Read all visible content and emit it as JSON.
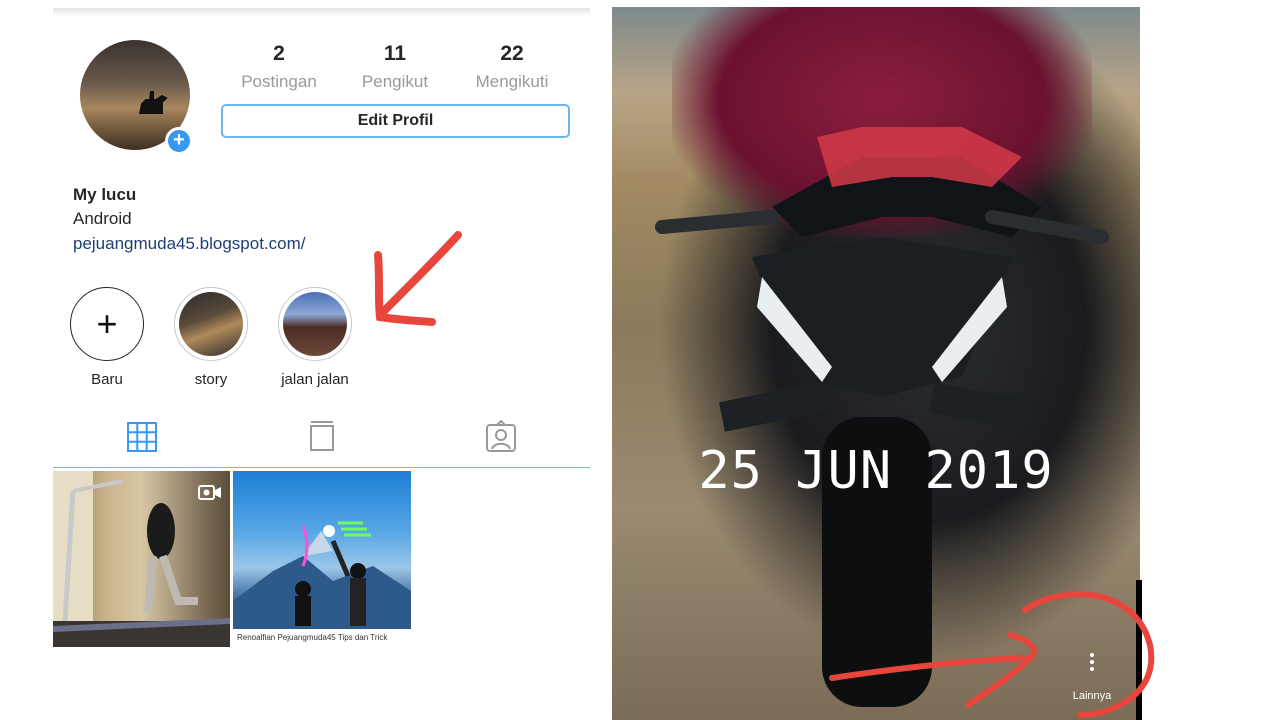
{
  "profile": {
    "stats": [
      {
        "count": "2",
        "label": "Postingan"
      },
      {
        "count": "11",
        "label": "Pengikut"
      },
      {
        "count": "22",
        "label": "Mengikuti"
      }
    ],
    "edit_button": "Edit Profil",
    "name": "My lucu",
    "bio": "Android",
    "link": "pejuangmuda45.blogspot.com/",
    "highlights": [
      {
        "label": "Baru",
        "icon": "plus-icon"
      },
      {
        "label": "story"
      },
      {
        "label": "jalan jalan"
      }
    ],
    "tabs": [
      {
        "icon": "grid-icon",
        "active": true
      },
      {
        "icon": "feed-icon",
        "active": false
      },
      {
        "icon": "tagged-icon",
        "active": false
      }
    ],
    "posts": [
      {
        "type": "video",
        "icon": "video-icon"
      },
      {
        "type": "image",
        "footer": "Renoalfian   Pejuangmuda45   Tips dan Trick"
      }
    ]
  },
  "story": {
    "date_text": "25 JUN 2019",
    "more_label": "Lainnya",
    "more_icon": "more-vertical-icon"
  },
  "colors": {
    "accent_blue": "#3897f0",
    "annotation_red": "#e8453c",
    "link_blue": "#1f3f72"
  }
}
